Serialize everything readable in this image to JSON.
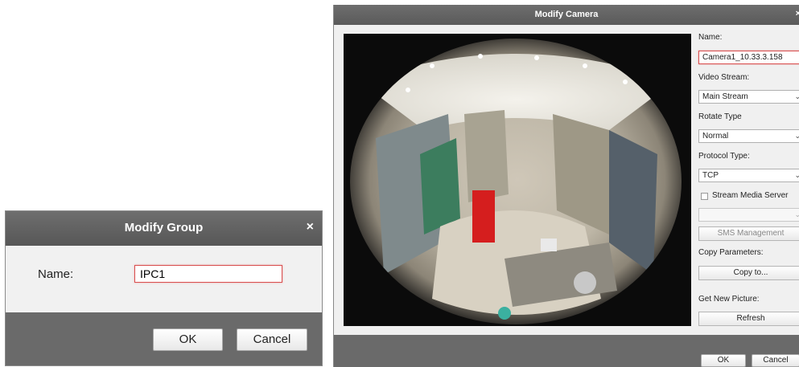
{
  "group_dialog": {
    "title": "Modify Group",
    "close_symbol": "×",
    "name_label": "Name:",
    "name_value": "IPC1",
    "ok_label": "OK",
    "cancel_label": "Cancel"
  },
  "camera_dialog": {
    "title": "Modify Camera",
    "name_label": "Name:",
    "name_value": "Camera1_10.33.3.158",
    "video_stream_label": "Video Stream:",
    "video_stream_value": "Main Stream",
    "rotate_type_label": "Rotate Type",
    "rotate_type_value": "Normal",
    "protocol_type_label": "Protocol Type:",
    "protocol_type_value": "TCP",
    "stream_media_server_label": "Stream Media Server",
    "stream_media_server_checked": false,
    "stream_media_server_value": "",
    "sms_management_label": "SMS Management",
    "copy_parameters_label": "Copy Parameters:",
    "copy_to_label": "Copy to...",
    "get_new_picture_label": "Get New Picture:",
    "refresh_label": "Refresh",
    "ok_label": "OK",
    "cancel_label": "Cancel",
    "preview_description_icon": "fisheye-store-preview"
  },
  "colors": {
    "titlebar": "#5f5f5f",
    "footer": "#6a6a6a",
    "dialog_bg": "#f0f0f0",
    "focus_border": "#d95050"
  }
}
